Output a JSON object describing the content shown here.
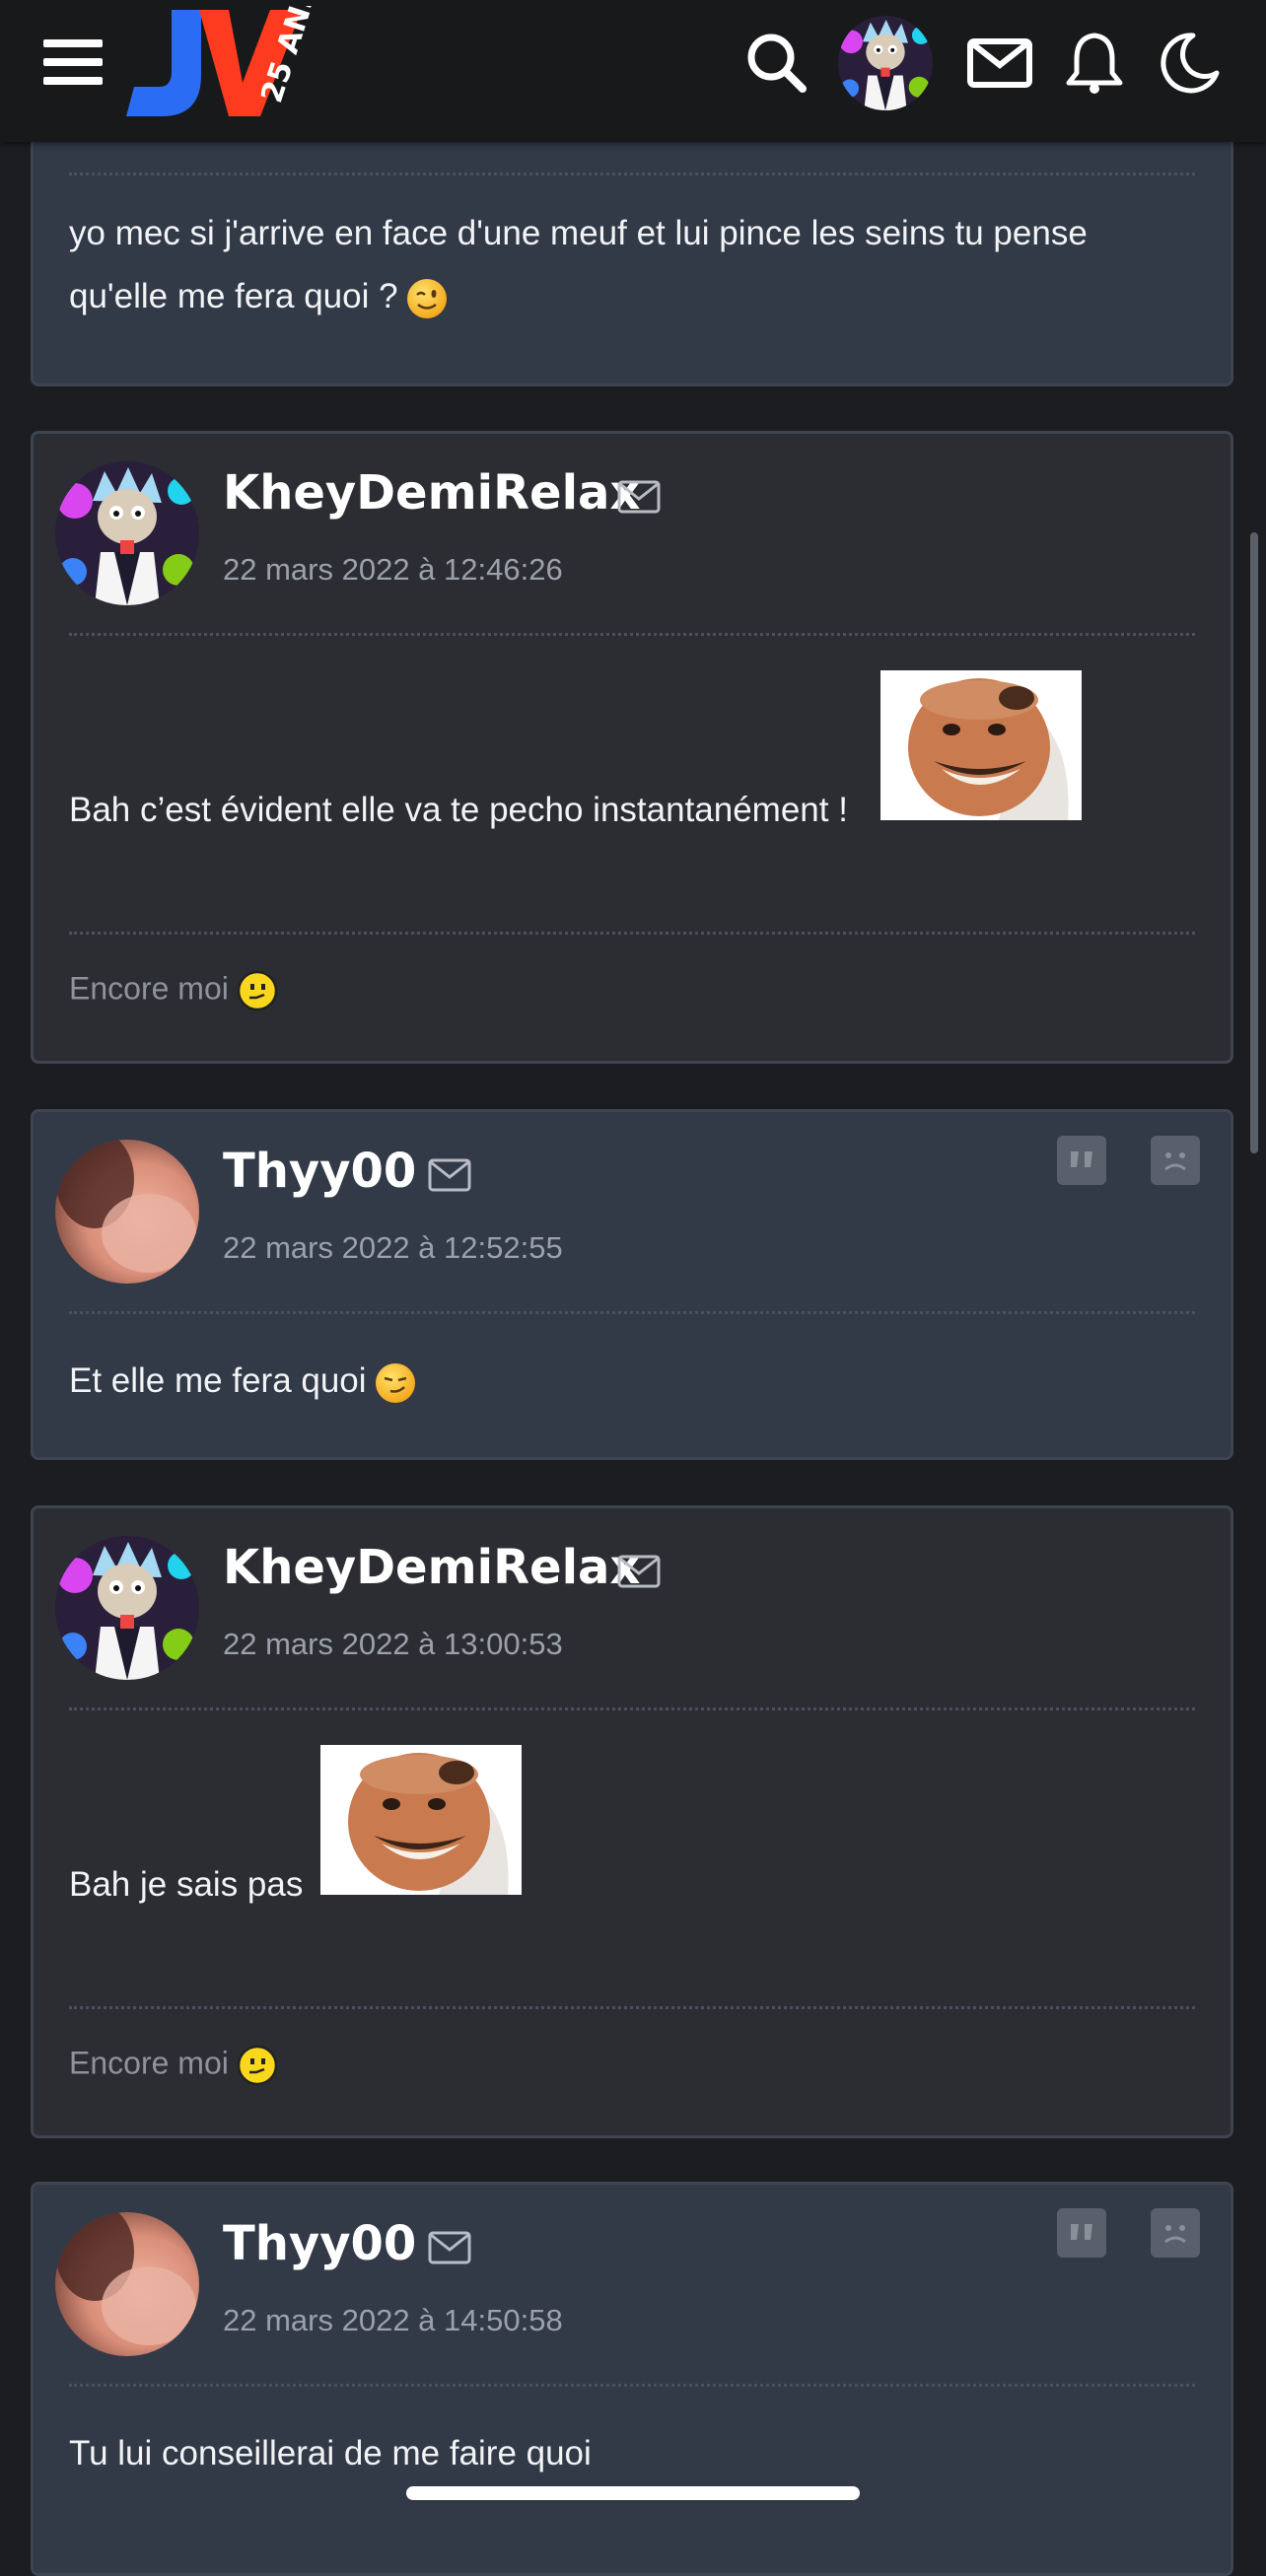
{
  "header": {
    "logo_text": "JV",
    "logo_badge": "25 ANS",
    "icons": [
      "menu-icon",
      "search-icon",
      "mail-icon",
      "bell-icon",
      "moon-icon"
    ]
  },
  "posts": [
    {
      "text": "yo mec si j'arrive en face d'une meuf et lui pince les seins tu pense qu'elle me fera quoi ?",
      "emoji": "wink"
    },
    {
      "author": "KheyDemiRelax",
      "date": "22 mars 2022 à 12:46:26",
      "text": "Bah c’est évident elle va te pecho instantanément !",
      "sticker": "risitas-sticker",
      "signature": "Encore moi"
    },
    {
      "author": "Thyy00",
      "date": "22 mars 2022 à 12:52:55",
      "text": "Et elle me fera quoi",
      "emoji": "smirk"
    },
    {
      "author": "KheyDemiRelax",
      "date": "22 mars 2022 à 13:00:53",
      "text": "Bah je sais pas",
      "sticker": "risitas-sticker",
      "signature": "Encore moi"
    },
    {
      "author": "Thyy00",
      "date": "22 mars 2022 à 14:50:58",
      "text": "Tu lui conseillerai de me faire quoi"
    }
  ],
  "colors": {
    "topbar": "#18191b",
    "post_dark": "#2b2d32",
    "post_blue": "#323a48",
    "border": "#3e4451",
    "logo_blue": "#2a6df4",
    "logo_red": "#ff3b1f"
  }
}
